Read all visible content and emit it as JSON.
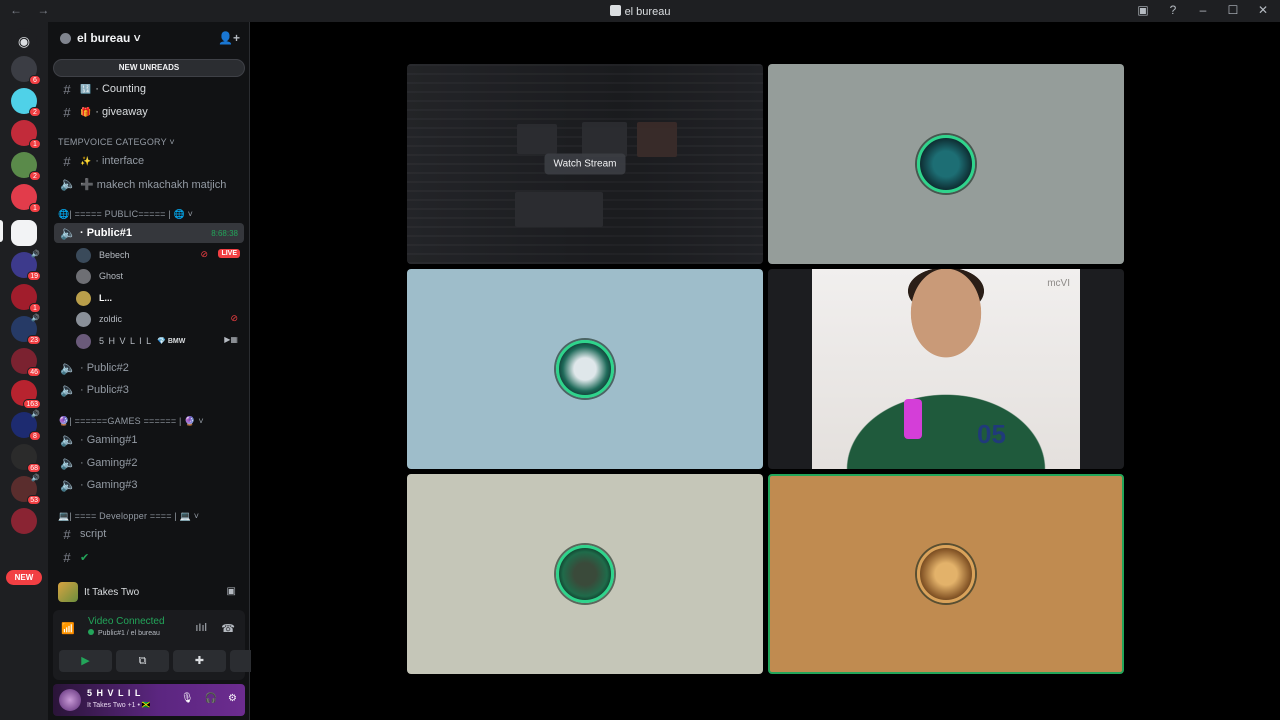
{
  "window": {
    "title": "el bureau",
    "nav": "← →"
  },
  "titlebar_icons": [
    "inbox-icon",
    "help-icon",
    "minimize-icon",
    "maximize-icon",
    "close-icon"
  ],
  "rail": {
    "servers": [
      {
        "name": "discord-home",
        "badge": ""
      },
      {
        "name": "server-1",
        "badge": "6"
      },
      {
        "name": "server-2",
        "badge": "2"
      },
      {
        "name": "server-3",
        "badge": "1"
      },
      {
        "name": "server-4",
        "badge": "2"
      },
      {
        "name": "server-5",
        "badge": "1"
      },
      {
        "name": "server-el-bureau",
        "badge": ""
      },
      {
        "name": "server-7",
        "badge": "19"
      },
      {
        "name": "server-8",
        "badge": "1"
      },
      {
        "name": "server-9",
        "badge": "23"
      },
      {
        "name": "server-10",
        "badge": "46"
      },
      {
        "name": "server-11",
        "badge": "163"
      },
      {
        "name": "server-12",
        "badge": "8"
      },
      {
        "name": "server-13",
        "badge": "68"
      },
      {
        "name": "server-14",
        "badge": "53"
      },
      {
        "name": "server-15",
        "badge": ""
      }
    ],
    "new_badge": "NEW"
  },
  "guild": {
    "name": "el bureau ˅"
  },
  "new_unreads": "NEW UNREADS",
  "channels": {
    "counting": {
      "emoji": "🔢",
      "label": "· Counting"
    },
    "giveaway": {
      "emoji": "🎁",
      "label": "· giveaway"
    },
    "tempvoice_category": "TEMPVOICE CATEGORY ˅",
    "interface": {
      "emoji": "✨",
      "label": "· interface"
    },
    "create": "➕ makech mkachakh matjich",
    "public_category": "🌐| ===== PUBLIC===== | 🌐 ˅",
    "public1": {
      "label": "· Public#1",
      "timer": "8:68:38"
    },
    "public2": "· Public#2",
    "public3": "· Public#3",
    "games_category": "🔮| ======GAMES ====== | 🔮 ˅",
    "gaming1": "· Gaming#1",
    "gaming2": "· Gaming#2",
    "gaming3": "· Gaming#3",
    "dev_category": "💻| ==== Developper ==== | 💻 ˅",
    "script": "script",
    "check": "✔"
  },
  "voice_users": [
    {
      "name": "Bebech",
      "live": "LIVE"
    },
    {
      "name": "Ghost"
    },
    {
      "name": "L..."
    },
    {
      "name": "zoldic"
    },
    {
      "name": "5 H V L I L",
      "tag": "💎 BMW"
    }
  ],
  "activity": {
    "name": "It Takes Two"
  },
  "voice_panel": {
    "status": "Video Connected",
    "location": "Public#1 / el bureau"
  },
  "user": {
    "name": "5 H V L I L",
    "status": "It Takes Two +1 • 🇯🇲"
  },
  "stage": {
    "watch_stream": "Watch Stream",
    "cam_watermark": "mcVI",
    "jacket_number": "05"
  },
  "colors": {
    "accent_green": "#23a55a",
    "danger_red": "#f23f43",
    "sidebar_bg": "#111214",
    "rail_bg": "#1e1f22"
  }
}
